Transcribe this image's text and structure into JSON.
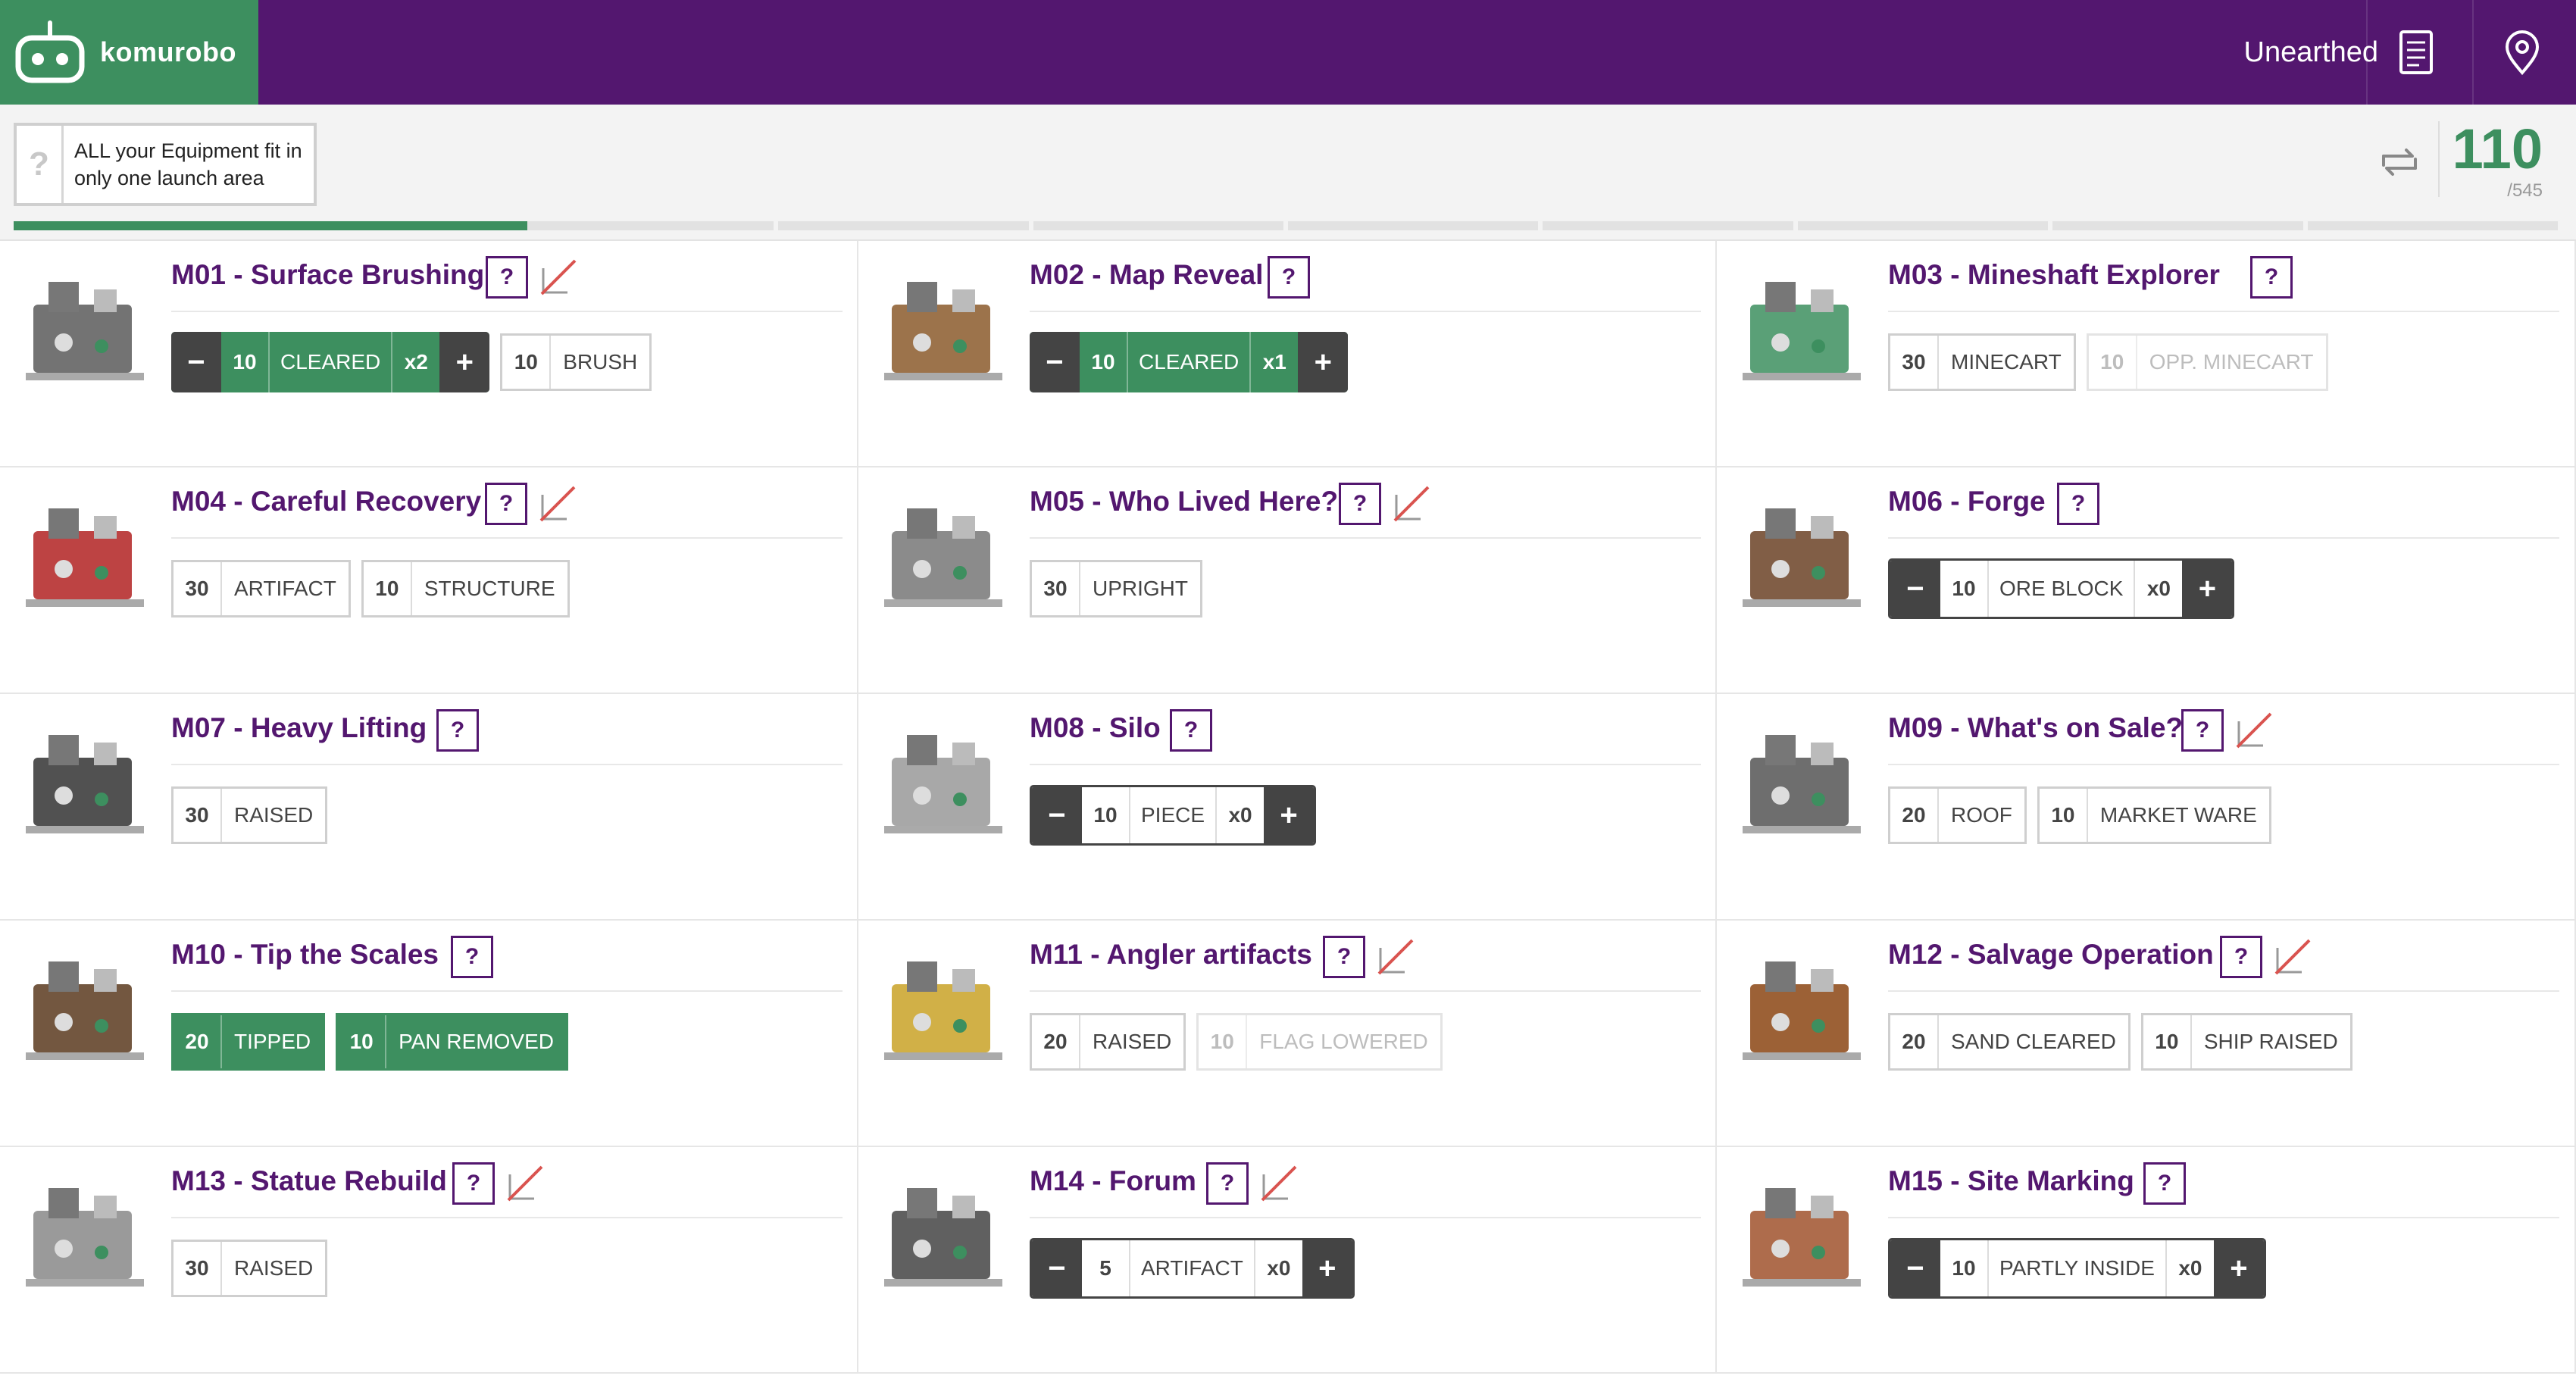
{
  "app": {
    "name": "komurobo",
    "season": "Unearthed"
  },
  "header": {
    "icons": [
      "document-icon",
      "map-pin-icon"
    ]
  },
  "equipment": {
    "help": "?",
    "text_line1": "ALL your Equipment fit in",
    "text_line2": "only one launch area"
  },
  "score": {
    "value": "110",
    "max": "/545",
    "progress_fraction": 0.2018
  },
  "colors": {
    "brand": "#53176f",
    "accent": "#3d8f5f",
    "neutral": "#444444"
  },
  "missions": [
    {
      "title": "M01 - Surface Brushing",
      "no_equipment_icon": true,
      "controls": [
        {
          "kind": "stepper",
          "points": "10",
          "label": "CLEARED",
          "count": "x2",
          "active": true
        },
        {
          "kind": "toggle",
          "points": "10",
          "label": "BRUSH",
          "state": "off"
        }
      ]
    },
    {
      "title": "M02 - Map Reveal",
      "no_equipment_icon": false,
      "controls": [
        {
          "kind": "stepper",
          "points": "10",
          "label": "CLEARED",
          "count": "x1",
          "active": true
        }
      ]
    },
    {
      "title": "M03 - Mineshaft Explorer",
      "no_equipment_icon": false,
      "controls": [
        {
          "kind": "toggle",
          "points": "30",
          "label": "MINECART",
          "state": "off"
        },
        {
          "kind": "toggle",
          "points": "10",
          "label": "OPP. MINECART",
          "state": "disabled"
        }
      ]
    },
    {
      "title": "M04 - Careful Recovery",
      "no_equipment_icon": true,
      "controls": [
        {
          "kind": "toggle",
          "points": "30",
          "label": "ARTIFACT",
          "state": "off"
        },
        {
          "kind": "toggle",
          "points": "10",
          "label": "STRUCTURE",
          "state": "off"
        }
      ]
    },
    {
      "title": "M05 - Who Lived Here?",
      "no_equipment_icon": true,
      "controls": [
        {
          "kind": "toggle",
          "points": "30",
          "label": "UPRIGHT",
          "state": "off"
        }
      ]
    },
    {
      "title": "M06 - Forge",
      "no_equipment_icon": false,
      "controls": [
        {
          "kind": "stepper",
          "points": "10",
          "label": "ORE BLOCK",
          "count": "x0",
          "active": false
        }
      ]
    },
    {
      "title": "M07 - Heavy Lifting",
      "no_equipment_icon": false,
      "controls": [
        {
          "kind": "toggle",
          "points": "30",
          "label": "RAISED",
          "state": "off"
        }
      ]
    },
    {
      "title": "M08 - Silo",
      "no_equipment_icon": false,
      "controls": [
        {
          "kind": "stepper",
          "points": "10",
          "label": "PIECE",
          "count": "x0",
          "active": false
        }
      ]
    },
    {
      "title": "M09 - What's on Sale?",
      "no_equipment_icon": true,
      "controls": [
        {
          "kind": "toggle",
          "points": "20",
          "label": "ROOF",
          "state": "off"
        },
        {
          "kind": "toggle",
          "points": "10",
          "label": "MARKET WARE",
          "state": "off"
        }
      ]
    },
    {
      "title": "M10 - Tip the Scales",
      "no_equipment_icon": false,
      "controls": [
        {
          "kind": "toggle",
          "points": "20",
          "label": "TIPPED",
          "state": "on"
        },
        {
          "kind": "toggle",
          "points": "10",
          "label": "PAN REMOVED",
          "state": "on"
        }
      ]
    },
    {
      "title": "M11 - Angler artifacts",
      "no_equipment_icon": true,
      "controls": [
        {
          "kind": "toggle",
          "points": "20",
          "label": "RAISED",
          "state": "off"
        },
        {
          "kind": "toggle",
          "points": "10",
          "label": "FLAG LOWERED",
          "state": "disabled"
        }
      ]
    },
    {
      "title": "M12 - Salvage Operation",
      "no_equipment_icon": true,
      "controls": [
        {
          "kind": "toggle",
          "points": "20",
          "label": "SAND CLEARED",
          "state": "off"
        },
        {
          "kind": "toggle",
          "points": "10",
          "label": "SHIP RAISED",
          "state": "off"
        }
      ]
    },
    {
      "title": "M13 - Statue Rebuild",
      "no_equipment_icon": true,
      "controls": [
        {
          "kind": "toggle",
          "points": "30",
          "label": "RAISED",
          "state": "off"
        }
      ]
    },
    {
      "title": "M14 - Forum",
      "no_equipment_icon": true,
      "controls": [
        {
          "kind": "stepper",
          "points": "5",
          "label": "ARTIFACT",
          "count": "x0",
          "active": false
        }
      ]
    },
    {
      "title": "M15 - Site Marking",
      "no_equipment_icon": false,
      "controls": [
        {
          "kind": "stepper",
          "points": "10",
          "label": "PARTLY INSIDE",
          "count": "x0",
          "active": false
        }
      ]
    }
  ],
  "labels": {
    "help": "?",
    "minus": "−",
    "plus": "+"
  }
}
